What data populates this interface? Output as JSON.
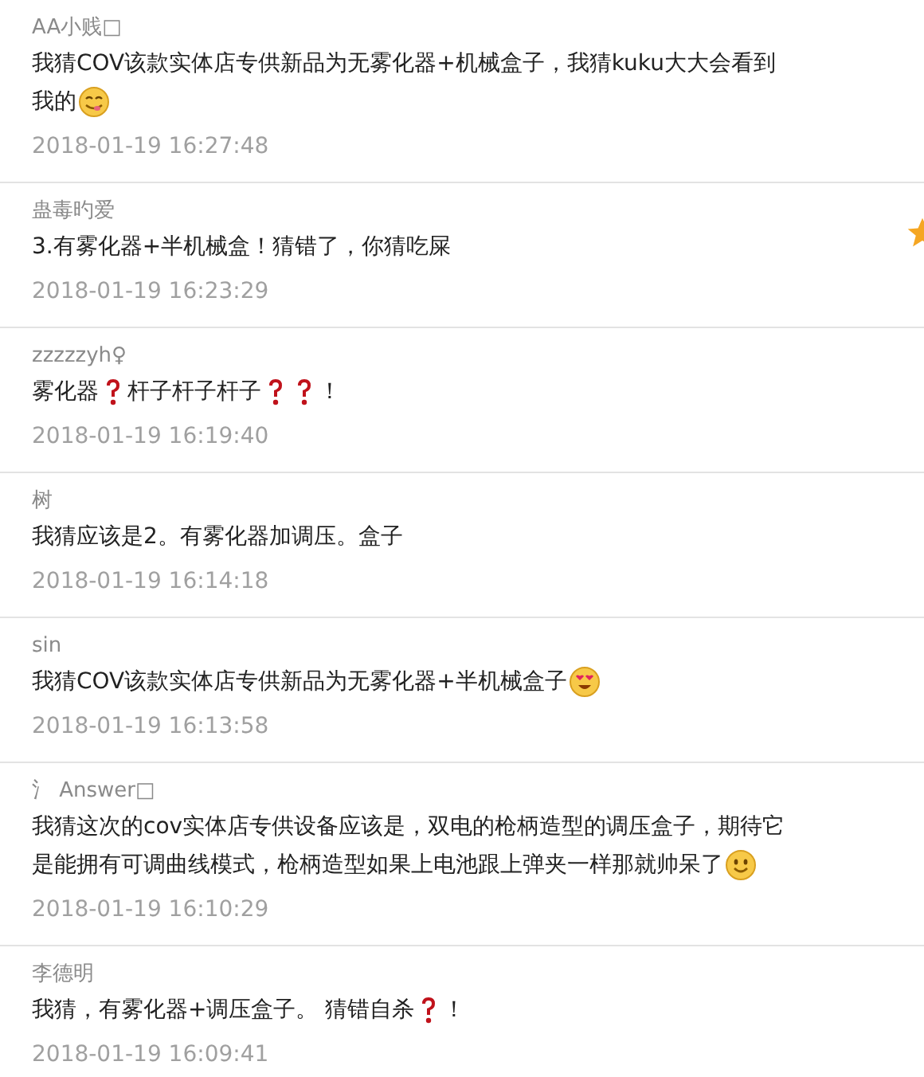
{
  "comments": [
    {
      "author": "AA小贱□",
      "starred": false,
      "lines": [
        [
          {
            "kind": "text",
            "text": "我猜COV该款实体店专供新品为无雾化器+机械盒子，我猜kuku大大会看到"
          }
        ],
        [
          {
            "kind": "text",
            "text": "我的"
          },
          {
            "kind": "drool"
          }
        ]
      ],
      "time": "2018-01-19 16:27:48"
    },
    {
      "author": "蛊毒旳爱",
      "starred": true,
      "lines": [
        [
          {
            "kind": "text",
            "text": "3.有雾化器+半机械盒！猜错了，你猜吃屎"
          }
        ]
      ],
      "time": "2018-01-19 16:23:29"
    },
    {
      "author": "zzzzzyh♀",
      "starred": false,
      "lines": [
        [
          {
            "kind": "text",
            "text": "雾化器"
          },
          {
            "kind": "question"
          },
          {
            "kind": "text",
            "text": "杆子杆子杆子"
          },
          {
            "kind": "question"
          },
          {
            "kind": "question"
          },
          {
            "kind": "text",
            "text": "！"
          }
        ]
      ],
      "time": "2018-01-19 16:19:40"
    },
    {
      "author": "树",
      "starred": false,
      "lines": [
        [
          {
            "kind": "text",
            "text": "我猜应该是2。有雾化器加调压。盒子"
          }
        ]
      ],
      "time": "2018-01-19 16:14:18"
    },
    {
      "author": "sin",
      "starred": false,
      "lines": [
        [
          {
            "kind": "text",
            "text": "我猜COV该款实体店专供新品为无雾化器+半机械盒子"
          },
          {
            "kind": "hearteyes"
          }
        ]
      ],
      "time": "2018-01-19 16:13:58"
    },
    {
      "author": "氵 Answer□",
      "starred": false,
      "lines": [
        [
          {
            "kind": "text",
            "text": "我猜这次的cov实体店专供设备应该是，双电的枪柄造型的调压盒子，期待它"
          }
        ],
        [
          {
            "kind": "text",
            "text": "是能拥有可调曲线模式，枪柄造型如果上电池跟上弹夹一样那就帅呆了"
          },
          {
            "kind": "smile"
          }
        ]
      ],
      "time": "2018-01-19 16:10:29"
    },
    {
      "author": "李德明",
      "starred": false,
      "lines": [
        [
          {
            "kind": "text",
            "text": "我猜，有雾化器+调压盒子。 猜错自杀"
          },
          {
            "kind": "question"
          },
          {
            "kind": "text",
            "text": "！"
          }
        ]
      ],
      "time": "2018-01-19 16:09:41"
    }
  ]
}
